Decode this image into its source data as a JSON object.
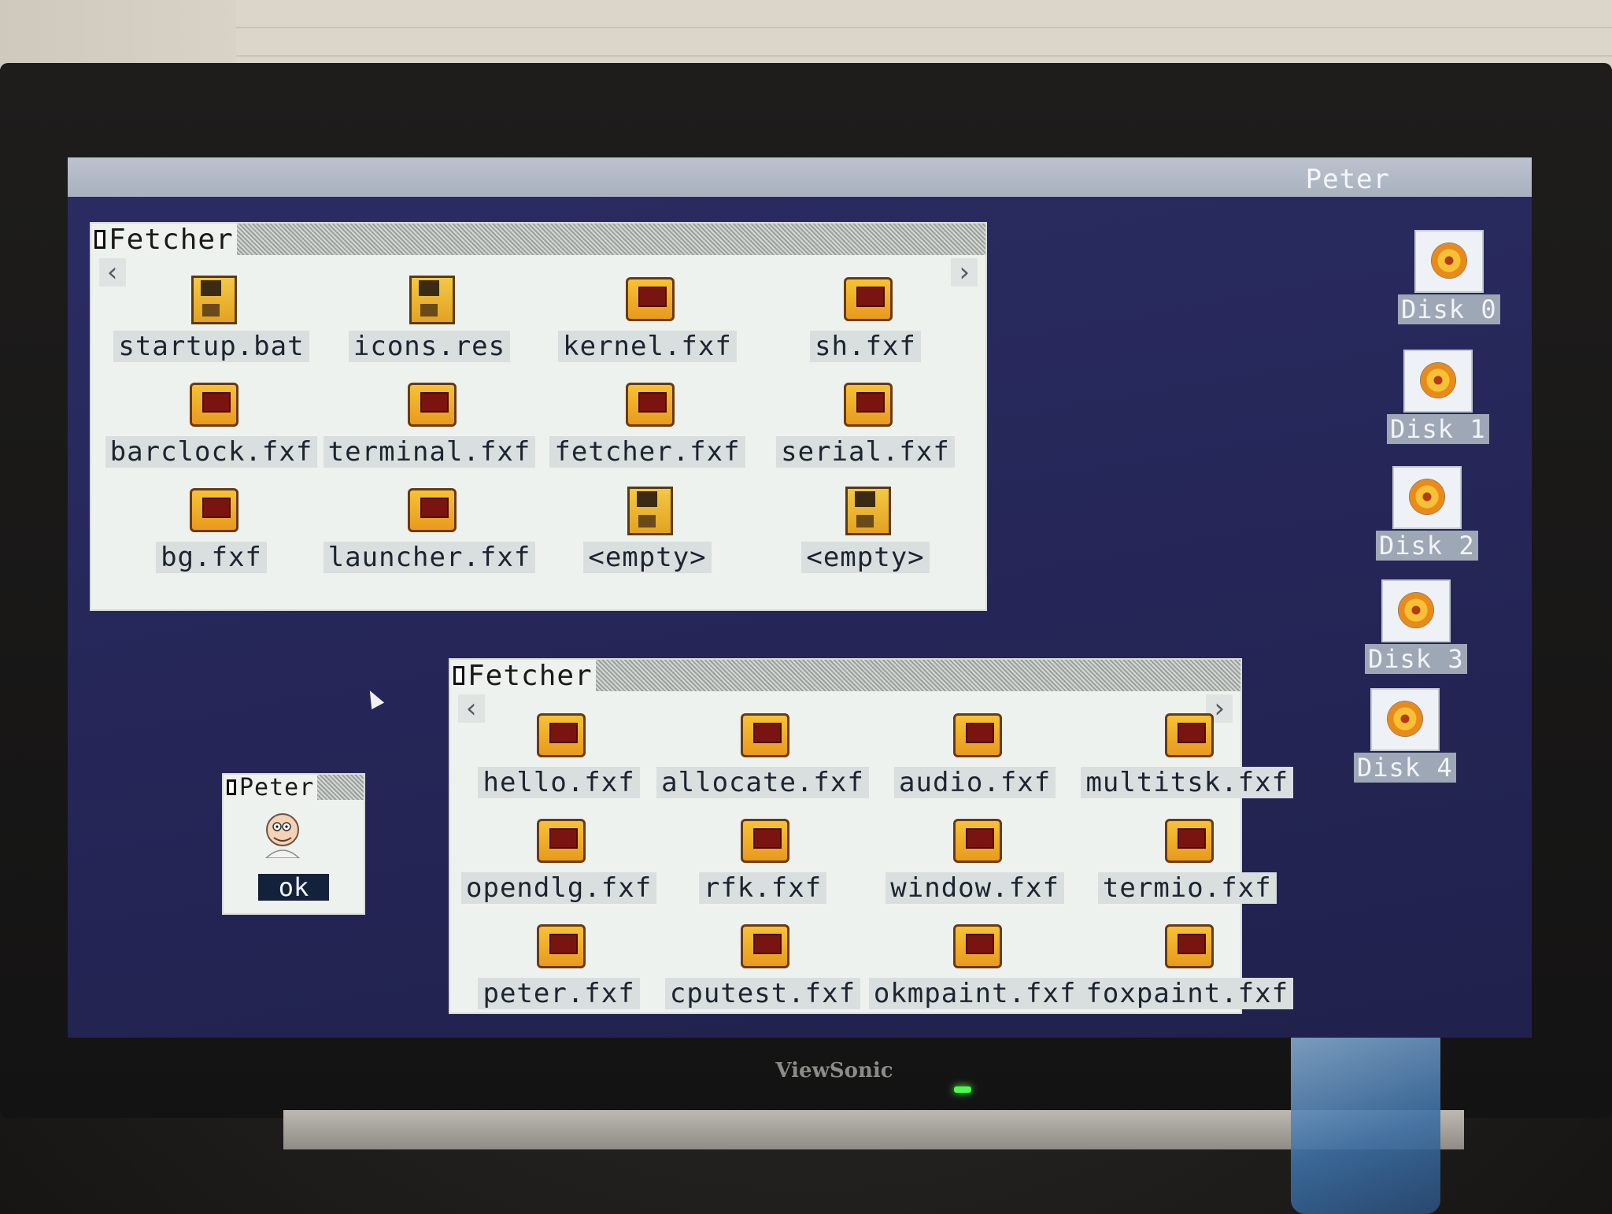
{
  "menubar": {
    "user": "Peter"
  },
  "fetcher1": {
    "title": "Fetcher",
    "items": [
      {
        "label": "startup.bat",
        "kind": "floppy-icon"
      },
      {
        "label": "icons.res",
        "kind": "floppy-icon"
      },
      {
        "label": "kernel.fxf",
        "kind": "app-icon"
      },
      {
        "label": "sh.fxf",
        "kind": "app-icon"
      },
      {
        "label": "barclock.fxf",
        "kind": "app-icon"
      },
      {
        "label": "terminal.fxf",
        "kind": "app-icon"
      },
      {
        "label": "fetcher.fxf",
        "kind": "app-icon"
      },
      {
        "label": "serial.fxf",
        "kind": "app-icon"
      },
      {
        "label": "bg.fxf",
        "kind": "app-icon"
      },
      {
        "label": "launcher.fxf",
        "kind": "app-icon"
      },
      {
        "label": "<empty>",
        "kind": "floppy-icon"
      },
      {
        "label": "<empty>",
        "kind": "floppy-icon"
      }
    ]
  },
  "fetcher2": {
    "title": "Fetcher",
    "items": [
      {
        "label": "hello.fxf",
        "kind": "app-icon"
      },
      {
        "label": "allocate.fxf",
        "kind": "app-icon"
      },
      {
        "label": "audio.fxf",
        "kind": "app-icon"
      },
      {
        "label": "multitsk.fxf",
        "kind": "app-icon"
      },
      {
        "label": "opendlg.fxf",
        "kind": "app-icon"
      },
      {
        "label": "rfk.fxf",
        "kind": "app-icon"
      },
      {
        "label": "window.fxf",
        "kind": "app-icon"
      },
      {
        "label": "termio.fxf",
        "kind": "app-icon"
      },
      {
        "label": "peter.fxf",
        "kind": "app-icon"
      },
      {
        "label": "cputest.fxf",
        "kind": "app-icon"
      },
      {
        "label": "okmpaint.fxf",
        "kind": "app-icon"
      },
      {
        "label": "foxpaint.fxf",
        "kind": "app-icon"
      }
    ]
  },
  "peter_window": {
    "title": "Peter",
    "ok_label": "ok"
  },
  "drives": [
    "Disk 0",
    "Disk 1",
    "Disk 2",
    "Disk 3",
    "Disk 4"
  ],
  "bezel": {
    "brand": "ViewSonic"
  }
}
